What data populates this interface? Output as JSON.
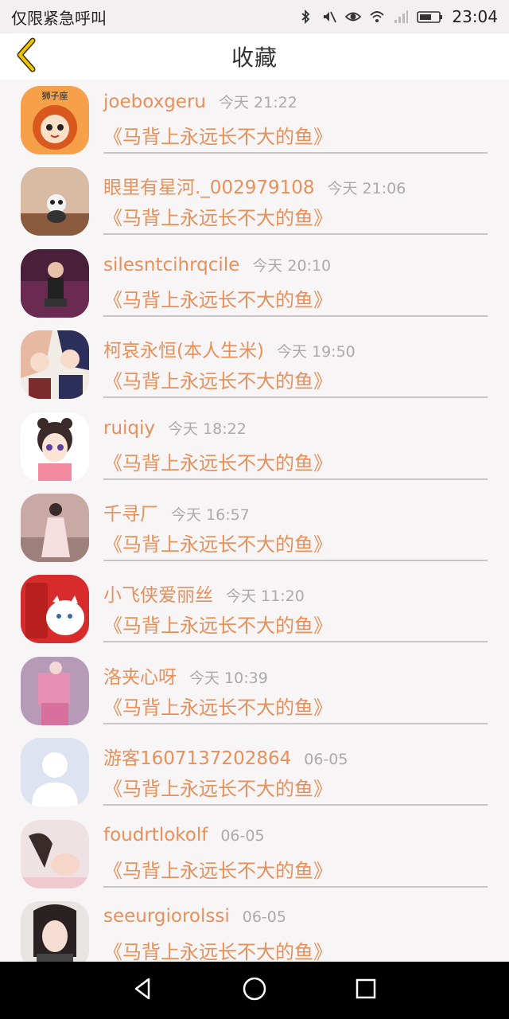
{
  "status_bar": {
    "carrier_text": "仅限紧急呼叫",
    "time": "23:04",
    "icons": [
      "bluetooth-icon",
      "mute-icon",
      "eye-icon",
      "wifi-icon",
      "signal-icon",
      "battery-icon"
    ]
  },
  "header": {
    "title": "收藏",
    "back_icon": "chevron-left-icon",
    "accent_color": "#f0c400"
  },
  "colors": {
    "username": "#e8905a",
    "title": "#e8905a",
    "timestamp": "#aaaaaa"
  },
  "items": [
    {
      "username": "joeboxgeru",
      "time": "今天 21:22",
      "title": "《马背上永远长不大的鱼》",
      "avatar": "cartoon-lion-costume-avatar"
    },
    {
      "username": "眼里有星河._002979108",
      "time": "今天 21:06",
      "title": "《马背上永远长不大的鱼》",
      "avatar": "panda-photo-avatar"
    },
    {
      "username": "silesntcihrqcile",
      "time": "今天 20:10",
      "title": "《马背上永远长不大的鱼》",
      "avatar": "man-on-sofa-avatar"
    },
    {
      "username": "柯哀永恒(本人生米)",
      "time": "今天 19:50",
      "title": "《马背上永远长不大的鱼》",
      "avatar": "anime-couple-avatar"
    },
    {
      "username": "ruiqiy",
      "time": "今天 18:22",
      "title": "《马背上永远长不大的鱼》",
      "avatar": "cartoon-girl-avatar"
    },
    {
      "username": "千寻厂",
      "time": "今天 16:57",
      "title": "《马背上永远长不大的鱼》",
      "avatar": "girl-in-dress-avatar"
    },
    {
      "username": "小飞侠爱丽丝",
      "time": "今天 11:20",
      "title": "《马背上永远长不大的鱼》",
      "avatar": "cola-cat-avatar"
    },
    {
      "username": "洛夹心呀",
      "time": "今天 10:39",
      "title": "《马背上永远长不大的鱼》",
      "avatar": "pink-outfit-avatar"
    },
    {
      "username": "游客1607137202864",
      "time": "06-05",
      "title": "《马背上永远长不大的鱼》",
      "avatar": "default-user-avatar"
    },
    {
      "username": "foudrtlokolf",
      "time": "06-05",
      "title": "《马背上永远长不大的鱼》",
      "avatar": "hand-photo-avatar"
    },
    {
      "username": "seeurgiorolssi",
      "time": "06-05",
      "title": "《马背上永远长不大的鱼》",
      "avatar": "girl-portrait-avatar"
    }
  ],
  "nav": {
    "back_icon": "nav-back-icon",
    "home_icon": "nav-home-icon",
    "recents_icon": "nav-recents-icon"
  }
}
